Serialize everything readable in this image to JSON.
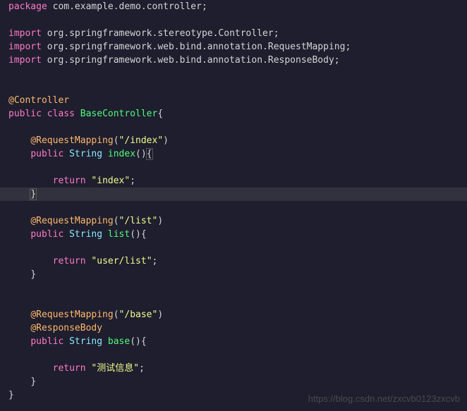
{
  "code": {
    "package_kw": "package",
    "package_name": " com.example.demo.controller",
    "import_kw": "import",
    "import1": " org.springframework.stereotype.Controller",
    "import2": " org.springframework.web.bind.annotation.RequestMapping",
    "import3": " org.springframework.web.bind.annotation.ResponseBody",
    "anno_controller": "@Controller",
    "public_kw": "public",
    "class_kw": "class",
    "classname": "BaseController",
    "anno_reqmapping": "@RequestMapping",
    "anno_respbody": "@ResponseBody",
    "string_type": "String",
    "method_index": "index",
    "method_list": "list",
    "method_base": "base",
    "return_kw": "return",
    "str_index_path": "\"/index\"",
    "str_index_ret": "\"index\"",
    "str_list_path": "\"/list\"",
    "str_list_ret": "\"user/list\"",
    "str_base_path": "\"/base\"",
    "str_base_ret": "\"测试信息\"",
    "semi": ";",
    "lparen": "(",
    "rparen": ")",
    "lbrace": "{",
    "rbrace": "}"
  },
  "watermark": "https://blog.csdn.net/zxcvb0123zxcvb"
}
